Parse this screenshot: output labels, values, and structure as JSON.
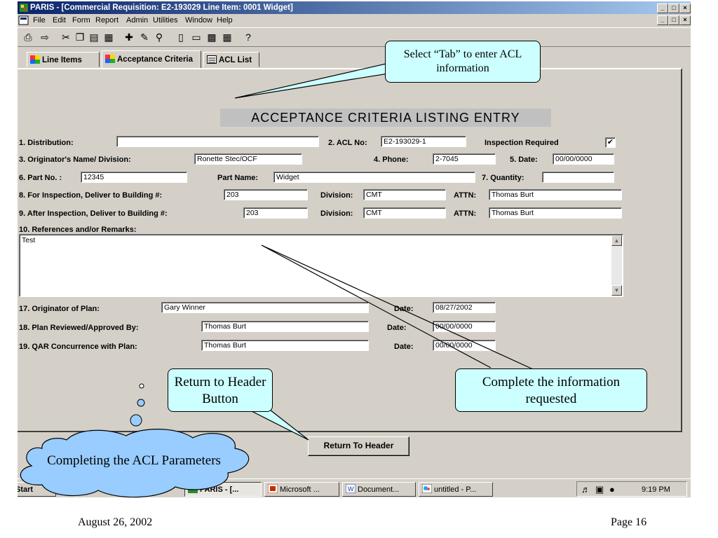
{
  "window": {
    "title": "PARIS - [Commercial Requisition: E2-193029 Line Item: 0001 Widget]",
    "caption_buttons": [
      "_",
      "ř",
      "×"
    ]
  },
  "menu": [
    "File",
    "Edit",
    "Form",
    "Report",
    "Admin",
    "Utilities",
    "Window",
    "Help"
  ],
  "toolbar": [
    "print-icon",
    "exit-icon",
    "cut-icon",
    "copy-icon",
    "paste-icon",
    "chart-icon",
    "add-record-icon",
    "erase-icon",
    "find-icon",
    "columns-icon",
    "window-icon",
    "tile-icon",
    "grid-icon",
    "help-icon"
  ],
  "tabs": [
    {
      "label": "Line Items",
      "icon": "puzzle-icon"
    },
    {
      "label": "Acceptance Criteria",
      "icon": "puzzle-icon"
    },
    {
      "label": "ACL List",
      "icon": "list-icon"
    }
  ],
  "form": {
    "heading": "ACCEPTANCE CRITERIA LISTING ENTRY",
    "distribution_label": "1.  Distribution:",
    "distribution_value": "",
    "acl_no_label": "2. ACL No:",
    "acl_no_value": "E2-193029-1",
    "inspection_label": "Inspection Required",
    "inspection_checked": "✔",
    "originator_label": "3. Originator's Name/ Division:",
    "originator_value": "Ronette Stec/OCF",
    "phone_label": "4.  Phone:",
    "phone_value": "2-7045",
    "date_label": "5.  Date:",
    "date_value": "00/00/0000",
    "part_no_label": "6.  Part No. :",
    "part_no_value": "12345",
    "part_name_label": "Part Name:",
    "part_name_value": "Widget",
    "quantity_label": "7.  Quantity:",
    "quantity_value": "",
    "for_insp_label": "8.  For Inspection, Deliver to Building #:",
    "for_insp_building": "203",
    "division_label": "Division:",
    "for_insp_division": "CMT",
    "attn_label": "ATTN:",
    "for_insp_attn": "Thomas Burt",
    "after_insp_label": "9.  After Inspection, Deliver to Building #:",
    "after_insp_building": "203",
    "after_insp_division": "CMT",
    "after_insp_attn": "Thomas Burt",
    "remarks_label": "10.  References and/or Remarks:",
    "remarks_value": "Test",
    "originator_plan_label": "17.  Originator of Plan:",
    "originator_plan_value": "Gary Winner",
    "plan_date_label": "Date:",
    "plan_date_value": "08/27/2002",
    "reviewed_label": "18.  Plan Reviewed/Approved By:",
    "reviewed_value": "Thomas Burt",
    "reviewed_date_label": "Date:",
    "reviewed_date_value": "00/00/0000",
    "qar_label": "19.  QAR Concurrence with Plan:",
    "qar_value": "Thomas Burt",
    "qar_date_label": "Date:",
    "qar_date_value": "00/00/0000"
  },
  "return_button": "Return To Header",
  "taskbar": {
    "start": "Start",
    "tasks": [
      "PARIS - [...",
      "Microsoft ...",
      "Document...",
      "untitled - P..."
    ],
    "clock": "9:19 PM"
  },
  "callouts": {
    "tab": "Select “Tab” to enter ACL information",
    "complete": "Complete the information requested",
    "return": "Return to Header Button",
    "cloud": "Completing the ACL Parameters"
  },
  "footer": {
    "date": "August 26, 2002",
    "page": "Page 16"
  },
  "colors": {
    "titlebar_start": "#0a246a",
    "titlebar_end": "#a6caf0",
    "window_face": "#d4d0c8",
    "callout_fill": "#ccffff",
    "cloud_fill": "#99ccff"
  }
}
